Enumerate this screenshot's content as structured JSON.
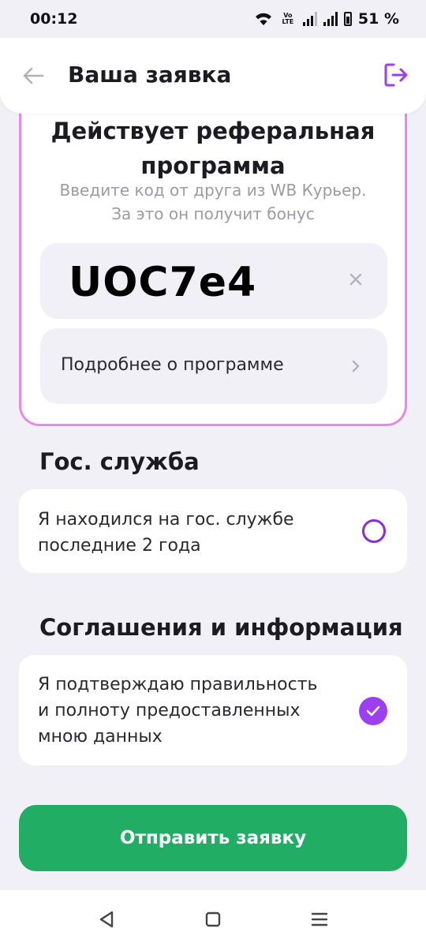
{
  "status_bar": {
    "time": "00:12",
    "network_label": "Vo LTE",
    "battery_percent": "51 %"
  },
  "header": {
    "title": "Ваша заявка",
    "back_icon": "arrow-left-icon",
    "exit_icon": "logout-icon"
  },
  "referral": {
    "title_line1": "Действует реферальная",
    "title_line2": "программа",
    "subtitle_line1": "Введите код от друга из WB Курьер.",
    "subtitle_line2": "За это он получит бонус",
    "code_value": "UOC7e4",
    "more_label": "Подробнее о программе"
  },
  "gov_service": {
    "section_title": "Гос. служба",
    "option_line1": "Я находился на гос. службе",
    "option_line2": "последние 2 года",
    "checked": false
  },
  "agreements": {
    "section_title": "Соглашения и информация",
    "option_line1": "Я подтверждаю правильность",
    "option_line2": "и полноту предоставленных",
    "option_line3": "мною данных",
    "checked": true
  },
  "submit_label": "Отправить заявку",
  "colors": {
    "accent_purple": "#9b3ff0",
    "card_border_pink": "#e48ae8",
    "submit_green": "#21ad64",
    "background": "#f1f0f7"
  }
}
